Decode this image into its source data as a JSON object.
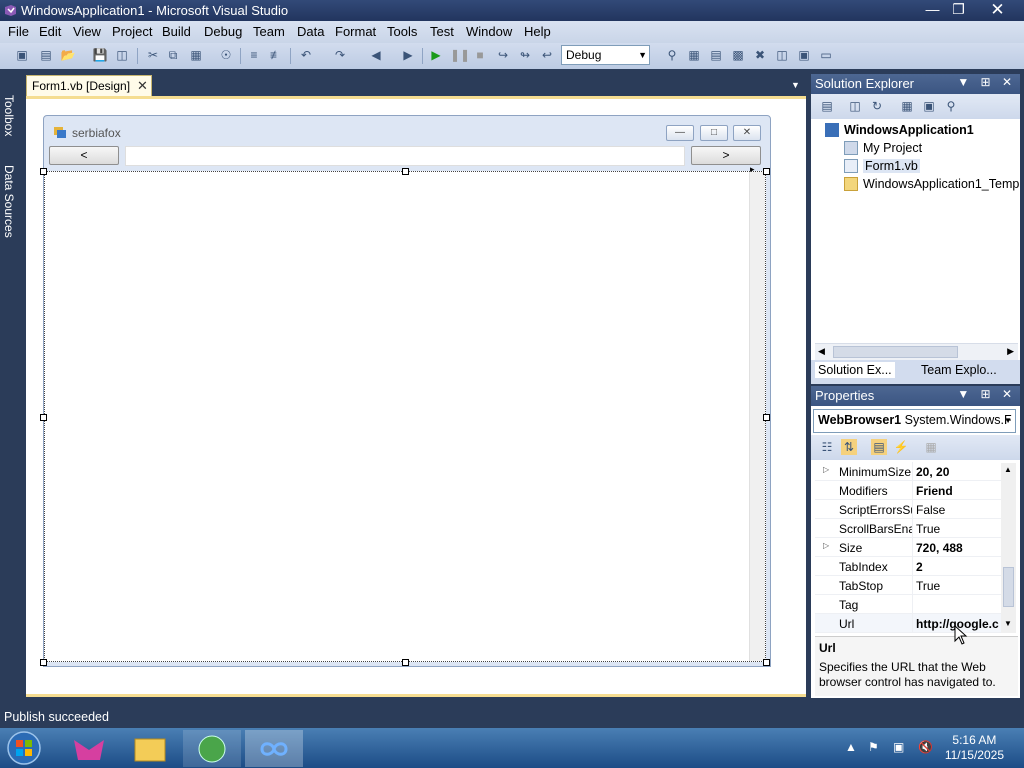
{
  "window": {
    "title": "WindowsApplication1 - Microsoft Visual Studio"
  },
  "menu": [
    "File",
    "Edit",
    "View",
    "Project",
    "Build",
    "Debug",
    "Team",
    "Data",
    "Format",
    "Tools",
    "Test",
    "Window",
    "Help"
  ],
  "toolbar": {
    "config_value": "Debug"
  },
  "sidebar": {
    "toolbox_label": "Toolbox",
    "datasources_label": "Data Sources"
  },
  "document": {
    "tab_label": "Form1.vb [Design]"
  },
  "form": {
    "title": "serbiafox",
    "back_label": "<",
    "forward_label": ">",
    "url_value": ""
  },
  "solution_explorer": {
    "title": "Solution Explorer",
    "items": [
      "WindowsApplication1",
      "My Project",
      "Form1.vb",
      "WindowsApplication1_Temp"
    ],
    "tabs": [
      "Solution Ex...",
      "Team Explo..."
    ]
  },
  "properties": {
    "title": "Properties",
    "object_name": "WebBrowser1",
    "object_type": "System.Windows.F",
    "rows": [
      {
        "name": "MinimumSize",
        "value": "20, 20",
        "bold": true,
        "expandable": true
      },
      {
        "name": "Modifiers",
        "value": "Friend",
        "bold": true,
        "expandable": false
      },
      {
        "name": "ScriptErrorsSu",
        "value": "False",
        "bold": false,
        "expandable": false
      },
      {
        "name": "ScrollBarsEnal",
        "value": "True",
        "bold": false,
        "expandable": false
      },
      {
        "name": "Size",
        "value": "720, 488",
        "bold": true,
        "expandable": true
      },
      {
        "name": "TabIndex",
        "value": "2",
        "bold": true,
        "expandable": false
      },
      {
        "name": "TabStop",
        "value": "True",
        "bold": false,
        "expandable": false
      },
      {
        "name": "Tag",
        "value": "",
        "bold": false,
        "expandable": false
      },
      {
        "name": "Url",
        "value": "http://google.c",
        "bold": true,
        "expandable": false
      }
    ],
    "description_title": "Url",
    "description_text": "Specifies the URL that the Web browser control has navigated to."
  },
  "status": {
    "text": "Publish succeeded"
  },
  "taskbar": {
    "time": "5:16 AM",
    "date": "11/15/2025"
  }
}
